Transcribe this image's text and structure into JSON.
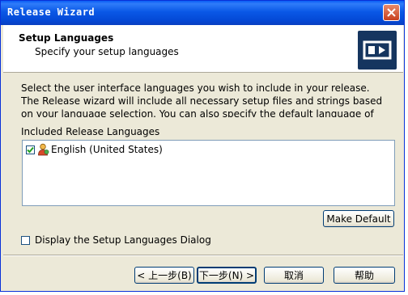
{
  "window": {
    "title": "Release Wizard"
  },
  "header": {
    "title": "Setup Languages",
    "subtitle": "Specify your setup languages"
  },
  "description": "Select the user interface languages you wish to include in your release. The Release wizard will include all necessary setup files and strings based on your language selection. You can also specify the default language of the setup and whether to show the language dialog.",
  "languages": {
    "label": "Included Release Languages",
    "items": [
      {
        "label": "English (United States)",
        "checked": true
      }
    ]
  },
  "make_default_label": "Make Default",
  "display_dialog": {
    "label": "Display the Setup Languages Dialog",
    "checked": false
  },
  "buttons": {
    "back": "< 上一步(B)",
    "next": "下一步(N) >",
    "cancel": "取消",
    "help": "帮助"
  },
  "colors": {
    "titlebar": "#0a58e6",
    "logo": "#15355f",
    "dialog_bg": "#ece9d8"
  }
}
